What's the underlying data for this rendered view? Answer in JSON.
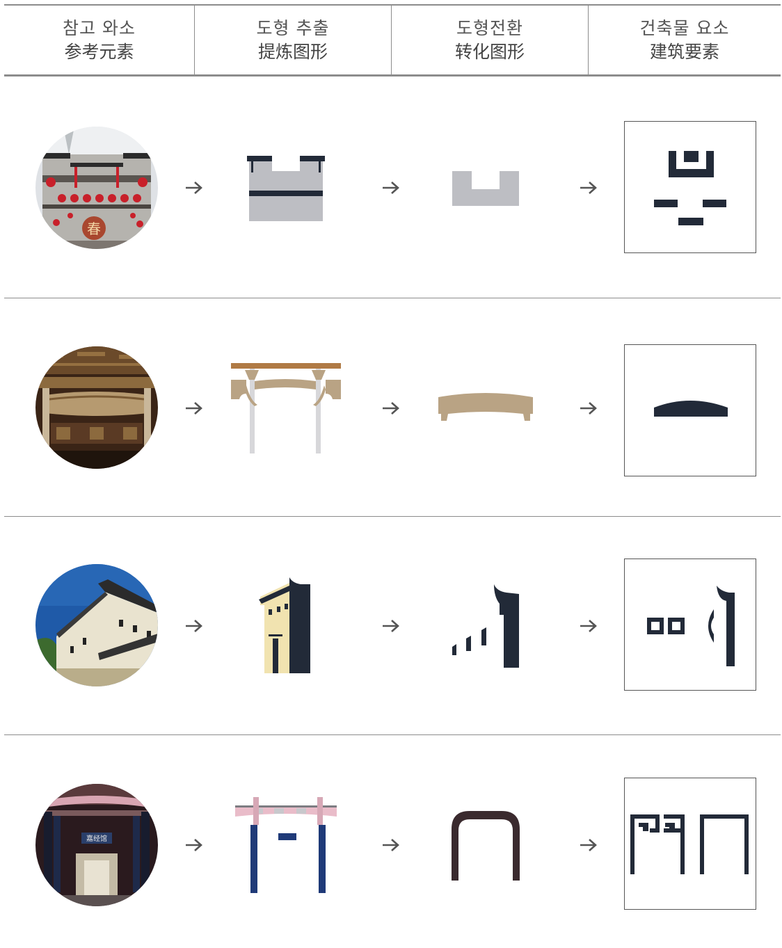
{
  "columns": [
    {
      "kr": "참고 와소",
      "zh": "参考元素"
    },
    {
      "kr": "도형 추출",
      "zh": "提炼图形"
    },
    {
      "kr": "도형전환",
      "zh": "转化图形"
    },
    {
      "kr": "건축물 요소",
      "zh": "建筑要素"
    }
  ],
  "rows": [
    {
      "photo": "gate-with-lanterns-photo",
      "photo_text": "春"
    },
    {
      "photo": "carved-beam-photo"
    },
    {
      "photo": "white-wall-house-photo"
    },
    {
      "photo": "hall-entrance-photo",
      "photo_text": "嘉经馆"
    }
  ],
  "colors": {
    "navy": "#222a38",
    "gray_shape": "#bdbec3",
    "tan": "#b9a384",
    "brown_bar": "#b07a45",
    "pink": "#e9bcc9",
    "blue_pillar": "#1f3a78",
    "dark_arch": "#3a2a2e",
    "cream": "#f1e3b0",
    "divider": "#8c8c8c"
  }
}
